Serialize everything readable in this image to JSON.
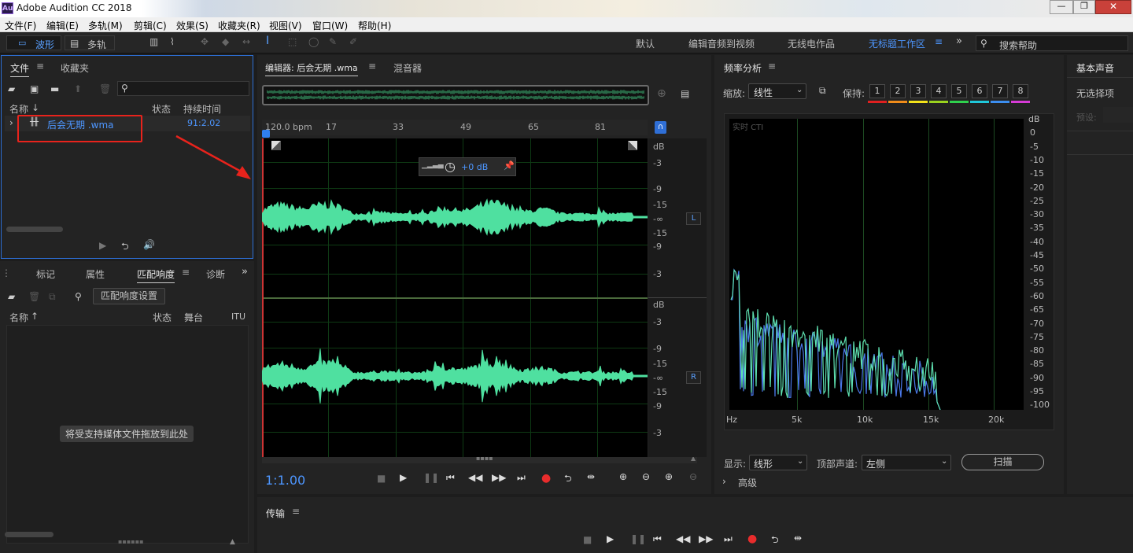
{
  "window": {
    "title": "Adobe Audition CC 2018",
    "app_badge": "Au",
    "controls": [
      "—",
      "❐",
      "✕"
    ]
  },
  "menu": [
    "文件(F)",
    "编辑(E)",
    "多轨(M)",
    "剪辑(C)",
    "效果(S)",
    "收藏夹(R)",
    "视图(V)",
    "窗口(W)",
    "帮助(H)"
  ],
  "toolbar": {
    "waveform_label": "波形",
    "multitrack_label": "多轨",
    "workspaces": [
      "默认",
      "编辑音频到视频",
      "无线电作品",
      "无标题工作区"
    ],
    "active_workspace": "无标题工作区",
    "search_placeholder": "搜索帮助"
  },
  "files": {
    "tab_files": "文件",
    "tab_favorites": "收藏夹",
    "col_name": "名称",
    "col_status": "状态",
    "col_duration": "持续时间",
    "file_name": "后会无期 .wma",
    "file_duration": "91:2.02"
  },
  "match": {
    "tabs": [
      "标记",
      "属性",
      "匹配响度",
      "诊断"
    ],
    "active_tab": "匹配响度",
    "settings_btn": "匹配响度设置",
    "col_name": "名称",
    "col_status": "状态",
    "col_stage": "舞台",
    "col_itu": "ITU",
    "drop_hint": "将受支持媒体文件拖放到此处"
  },
  "editor": {
    "tab_editor": "编辑器: 后会无期 .wma",
    "tab_mixer": "混音器",
    "ruler": [
      "120.0 bpm",
      "17",
      "33",
      "49",
      "65",
      "81"
    ],
    "hud_gain": "+0 dB",
    "db_scale_L": [
      "dB",
      "-3",
      "-9",
      "-15",
      "-∞",
      "-15",
      "-9",
      "-3"
    ],
    "db_scale_R": [
      "dB",
      "-3",
      "-9",
      "-15",
      "-∞",
      "-15",
      "-9",
      "-3"
    ],
    "channel_L": "L",
    "channel_R": "R",
    "time": "1:1.00"
  },
  "freq": {
    "title": "频率分析",
    "scale_label": "缩放:",
    "scale_value": "线性",
    "hold_label": "保持:",
    "hold_buttons": [
      "1",
      "2",
      "3",
      "4",
      "5",
      "6",
      "7",
      "8"
    ],
    "hold_colors": [
      "#e02020",
      "#f08c1a",
      "#f2e21a",
      "#9ad21e",
      "#2fd14d",
      "#1fc7d9",
      "#3c8ef0",
      "#d63bd6"
    ],
    "live_label": "实时 CTI",
    "db_ticks": [
      "dB",
      "0",
      "-5",
      "-10",
      "-15",
      "-20",
      "-25",
      "-30",
      "-35",
      "-40",
      "-45",
      "-50",
      "-55",
      "-60",
      "-65",
      "-70",
      "-75",
      "-80",
      "-85",
      "-90",
      "-95",
      "-100"
    ],
    "hz_ticks": [
      "Hz",
      "5k",
      "10k",
      "15k",
      "20k"
    ],
    "display_label": "显示:",
    "display_value": "线形",
    "channel_label": "顶部声道:",
    "channel_value": "左侧",
    "scan_btn": "扫描",
    "advanced": "高级"
  },
  "essential": {
    "title": "基本声音",
    "no_selection": "无选择项",
    "preset_label": "预设:"
  },
  "transport": {
    "title": "传输"
  }
}
